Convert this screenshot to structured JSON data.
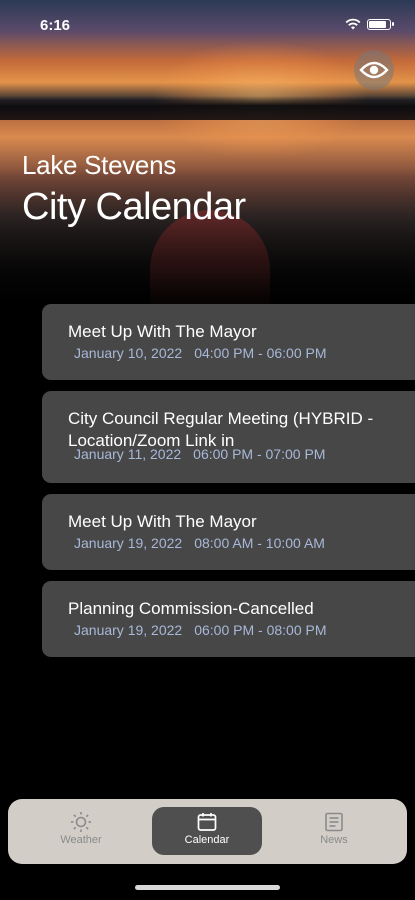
{
  "status_bar": {
    "time": "6:16"
  },
  "header": {
    "subtitle": "Lake Stevens",
    "title": "City Calendar"
  },
  "icons": {
    "visibility": "eye-icon",
    "weather": "sun-icon",
    "calendar": "calendar-icon",
    "news": "newspaper-icon"
  },
  "events": [
    {
      "title": "Meet Up With The Mayor",
      "date": "January 10, 2022",
      "time": "04:00 PM - 06:00 PM"
    },
    {
      "title": "City Council Regular Meeting (HYBRID - Location/Zoom Link in",
      "date": "January 11, 2022",
      "time": "06:00 PM - 07:00 PM"
    },
    {
      "title": "Meet Up With The Mayor",
      "date": "January 19, 2022",
      "time": "08:00 AM - 10:00 AM"
    },
    {
      "title": "Planning Commission-Cancelled",
      "date": "January 19, 2022",
      "time": "06:00 PM - 08:00 PM"
    }
  ],
  "tabs": [
    {
      "label": "Weather",
      "active": false
    },
    {
      "label": "Calendar",
      "active": true
    },
    {
      "label": "News",
      "active": false
    }
  ],
  "colors": {
    "card": "#474747",
    "date_text": "#a8b8d8",
    "tabbar": "#d2cec7",
    "active_tab": "#4f4f4f"
  }
}
